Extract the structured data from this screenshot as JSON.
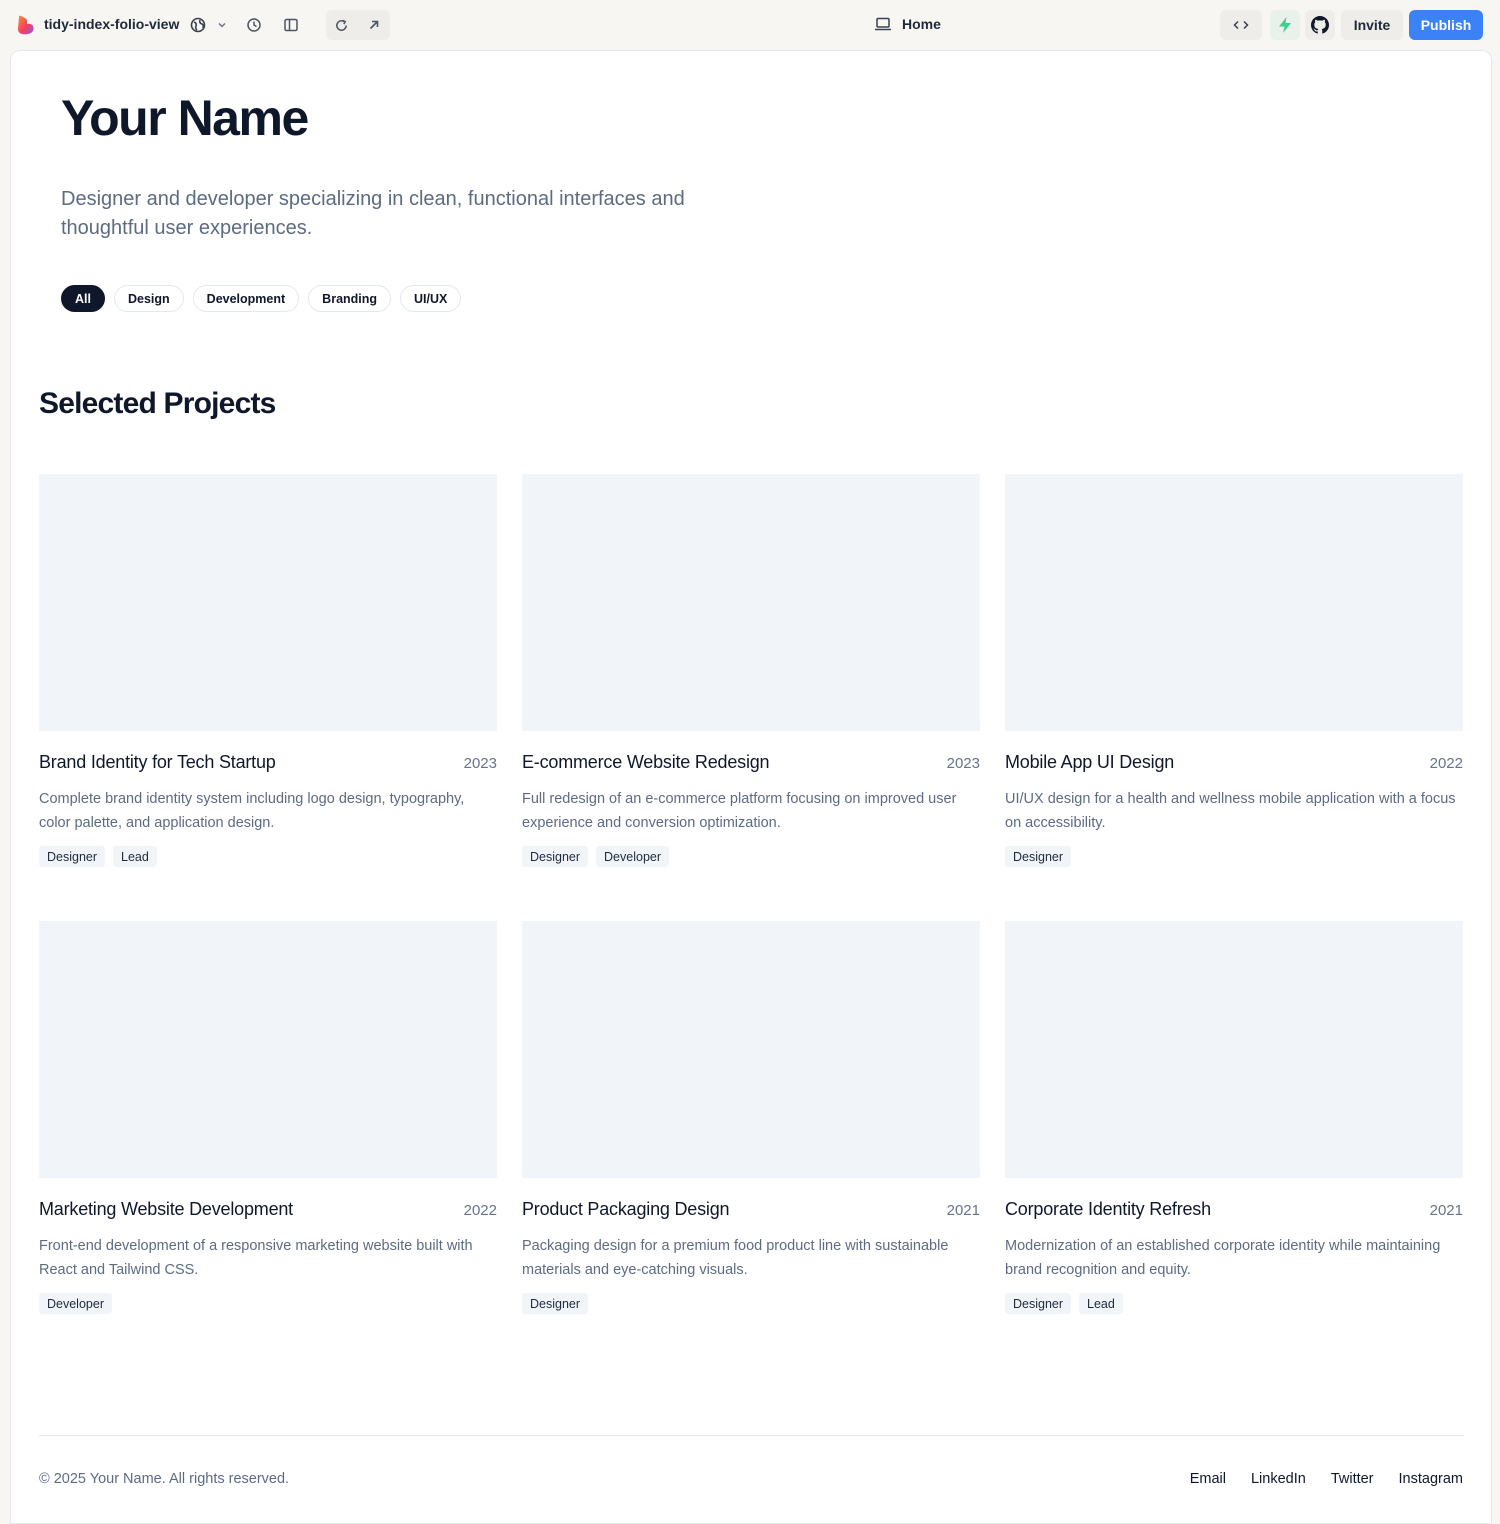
{
  "topbar": {
    "project_name": "tidy-index-folio-view",
    "globe_icon": "globe-icon",
    "page_label": "Home",
    "invite_label": "Invite",
    "publish_label": "Publish",
    "publish_color": "#3b82f6"
  },
  "hero": {
    "name": "Your Name",
    "tagline": "Designer and developer specializing in clean, functional interfaces and thoughtful user experiences."
  },
  "filters": [
    "All",
    "Design",
    "Development",
    "Branding",
    "UI/UX"
  ],
  "active_filter": "All",
  "section_title": "Selected Projects",
  "projects": [
    {
      "title": "Brand Identity for Tech Startup",
      "year": "2023",
      "description": "Complete brand identity system including logo design, typography, color palette, and application design.",
      "tags": [
        "Designer",
        "Lead"
      ]
    },
    {
      "title": "E-commerce Website Redesign",
      "year": "2023",
      "description": "Full redesign of an e-commerce platform focusing on improved user experience and conversion optimization.",
      "tags": [
        "Designer",
        "Developer"
      ]
    },
    {
      "title": "Mobile App UI Design",
      "year": "2022",
      "description": "UI/UX design for a health and wellness mobile application with a focus on accessibility.",
      "tags": [
        "Designer"
      ]
    },
    {
      "title": "Marketing Website Development",
      "year": "2022",
      "description": "Front-end development of a responsive marketing website built with React and Tailwind CSS.",
      "tags": [
        "Developer"
      ]
    },
    {
      "title": "Product Packaging Design",
      "year": "2021",
      "description": "Packaging design for a premium food product line with sustainable materials and eye-catching visuals.",
      "tags": [
        "Designer"
      ]
    },
    {
      "title": "Corporate Identity Refresh",
      "year": "2021",
      "description": "Modernization of an established corporate identity while maintaining brand recognition and equity.",
      "tags": [
        "Designer",
        "Lead"
      ]
    }
  ],
  "footer": {
    "copyright": "© 2025 Your Name. All rights reserved.",
    "links": [
      "Email",
      "LinkedIn",
      "Twitter",
      "Instagram"
    ]
  }
}
